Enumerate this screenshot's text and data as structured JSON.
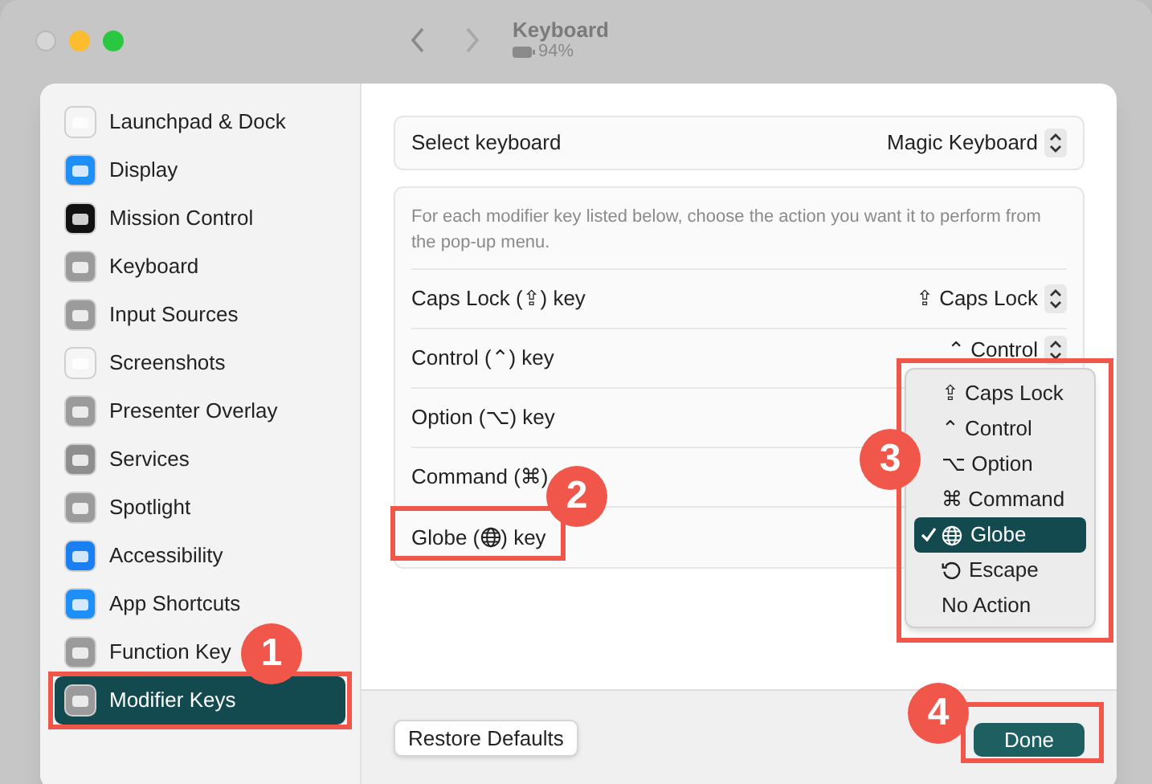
{
  "window": {
    "title": "Keyboard",
    "battery": "94%"
  },
  "sidebar": {
    "items": [
      {
        "label": "Launchpad & Dock",
        "selected": false
      },
      {
        "label": "Display",
        "selected": false
      },
      {
        "label": "Mission Control",
        "selected": false
      },
      {
        "label": "Keyboard",
        "selected": false
      },
      {
        "label": "Input Sources",
        "selected": false
      },
      {
        "label": "Screenshots",
        "selected": false
      },
      {
        "label": "Presenter Overlay",
        "selected": false
      },
      {
        "label": "Services",
        "selected": false
      },
      {
        "label": "Spotlight",
        "selected": false
      },
      {
        "label": "Accessibility",
        "selected": false
      },
      {
        "label": "App Shortcuts",
        "selected": false
      },
      {
        "label": "Function Key",
        "selected": false
      },
      {
        "label": "Modifier Keys",
        "selected": true
      }
    ]
  },
  "select_keyboard": {
    "label": "Select keyboard",
    "value": "Magic Keyboard"
  },
  "description": "For each modifier key listed below, choose the action you want it to perform from the pop-up menu.",
  "rows": [
    {
      "label": "Caps Lock (⇪) key",
      "value": "⇪ Caps Lock"
    },
    {
      "label": "Control (⌃) key",
      "value": "⌃ Control"
    },
    {
      "label": "Option (⌥) key"
    },
    {
      "label": "Command (⌘)"
    },
    {
      "label": "Globe (",
      "kind": "globe",
      "label_end": ") key"
    }
  ],
  "menu": [
    {
      "symbol": "⇪",
      "label": "Caps Lock",
      "selected": false
    },
    {
      "symbol": "⌃",
      "label": "Control",
      "selected": false
    },
    {
      "symbol": "⌥",
      "label": "Option",
      "selected": false
    },
    {
      "symbol": "⌘",
      "label": "Command",
      "selected": false
    },
    {
      "kind": "globe",
      "label": "Globe",
      "selected": true
    },
    {
      "kind": "escape",
      "label": "Escape",
      "selected": false
    },
    {
      "label": "No Action",
      "selected": false
    }
  ],
  "buttons": {
    "restore": "Restore Defaults",
    "done": "Done"
  },
  "annotations": [
    {
      "number": "1"
    },
    {
      "number": "2"
    },
    {
      "number": "3"
    },
    {
      "number": "4"
    }
  ]
}
